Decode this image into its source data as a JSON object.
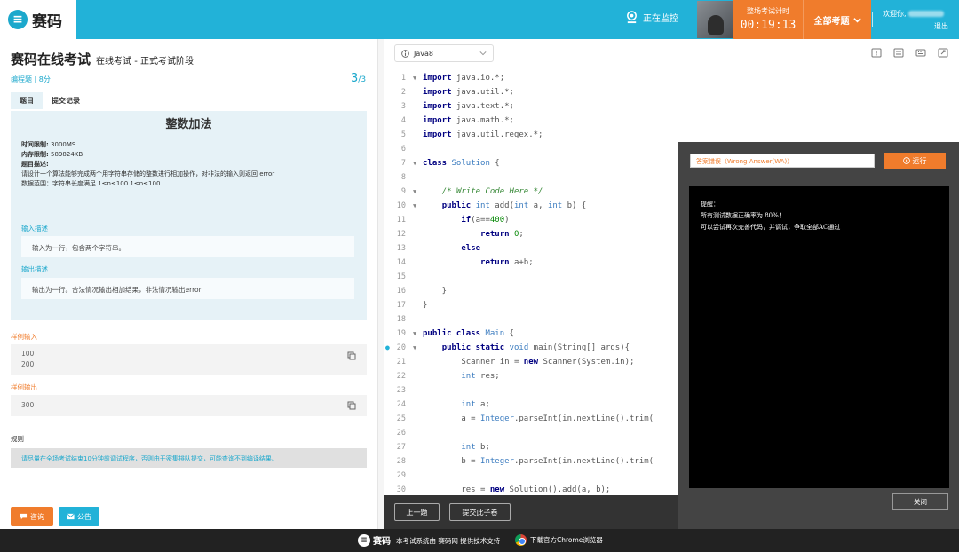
{
  "header": {
    "logo_mark": "≡",
    "logo_text": "赛码",
    "monitor_text": "正在监控",
    "timer_label": "整场考试计时",
    "timer_value": "00:19:13",
    "all_questions": "全部考题",
    "welcome": "欢迎你,",
    "logout": "退出"
  },
  "left": {
    "title": "赛码在线考试",
    "subtitle": "在线考试 - 正式考试阶段",
    "meta": "编程题 | 8分",
    "pager_current": "3",
    "pager_total": "/3",
    "tabs": [
      {
        "label": "题目"
      },
      {
        "label": "提交记录"
      }
    ],
    "problem": {
      "title": "整数加法",
      "time_limit_label": "时间限制:",
      "time_limit": "3000MS",
      "memory_limit_label": "内存限制:",
      "memory_limit": "589824KB",
      "desc_label": "题目描述:",
      "desc": "请设计一个算法能够完成两个用字符串存储的整数进行相加操作，对非法的输入则返回 error",
      "range": "数据范围：字符串长度满足 1≤n≤100 1≤n≤100"
    },
    "input_label": "输入描述",
    "input_desc": "输入为一行，包含两个字符串。",
    "output_label": "输出描述",
    "output_desc": "输出为一行。合法情况输出相加结果，非法情况输出error",
    "sample_input_label": "样例输入",
    "sample_input": [
      "100",
      "200"
    ],
    "sample_output_label": "样例输出",
    "sample_output": "300",
    "rules_label": "规则",
    "rules_text": "请尽量在全场考试结束10分钟前调试程序，否则由于密集排队提交，可能查询不到编译结果。",
    "consult_btn": "咨询",
    "notice_btn": "公告"
  },
  "editor": {
    "language": "Java8",
    "prev_btn": "上一题",
    "submit_btn": "提交此子卷"
  },
  "result": {
    "status": "答案错误（Wrong Answer(WA)）",
    "run_btn": "运行",
    "console_lines": [
      "提醒：",
      "所有测试数据正确率为 80%！",
      "可以尝试再次完善代码，并调试，争取全部AC通过"
    ],
    "close_btn": "关闭"
  },
  "footer": {
    "logo_text": "赛码",
    "text": "本考试系统由 赛码网 提供技术支持",
    "chrome_text": "下载官方Chrome浏览器"
  },
  "colors": {
    "brand": "#22b2d8",
    "accent": "#f07c2c",
    "footer": "#222222"
  }
}
